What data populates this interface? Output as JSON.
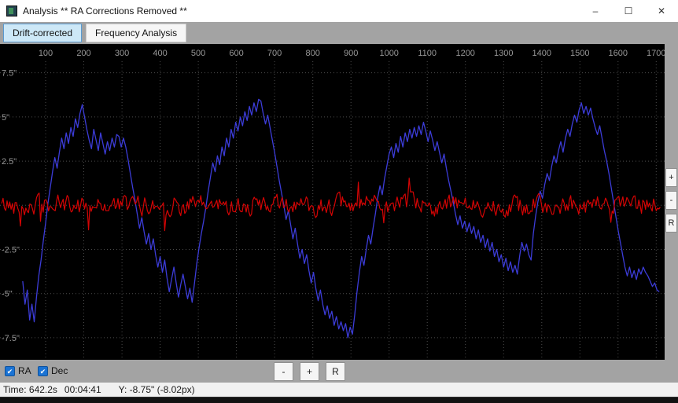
{
  "window": {
    "title": "Analysis ** RA Corrections Removed **",
    "controls": {
      "minimize": "–",
      "maximize": "☐",
      "close": "✕"
    }
  },
  "tabs": [
    {
      "label": "Drift-corrected",
      "selected": true
    },
    {
      "label": "Frequency Analysis",
      "selected": false
    }
  ],
  "icons": {
    "check": "✔"
  },
  "side_controls": {
    "zoom_in": "+",
    "zoom_out": "-",
    "reset": "R"
  },
  "bottom_controls": {
    "checkboxes": [
      {
        "label": "RA",
        "checked": true
      },
      {
        "label": "Dec",
        "checked": true
      }
    ],
    "buttons": [
      "-",
      "+",
      "R"
    ]
  },
  "status_bar": {
    "time": "Time: 642.2s",
    "clock": "00:04:41",
    "y_readout": "Y: -8.75\" (-8.02px)"
  },
  "colors": {
    "window_bg": "#ffffff",
    "strip_bg": "#a3a3a3",
    "chart_bg": "#000000",
    "grid": "#4c4c4c",
    "tick_text": "#989898",
    "dec_line": "#3c3cd8",
    "ra_line": "#d40404",
    "selected_tab_bg": "#cde8f7",
    "selected_tab_border": "#5b9bd0",
    "checkbox_blue": "#1a73d4",
    "status_bg": "#f1f1f1"
  },
  "chart_data": {
    "type": "line",
    "title": "",
    "xlabel": "",
    "ylabel": "",
    "grid": true,
    "xlim": [
      -19.6,
      1722
    ],
    "ylim": [
      -8.75,
      9.13
    ],
    "x_ticks": [
      100,
      200,
      300,
      400,
      500,
      600,
      700,
      800,
      900,
      1000,
      1100,
      1200,
      1300,
      1400,
      1500,
      1600,
      1700
    ],
    "y_ticks": [
      {
        "value": 7.5,
        "label": "7.5\""
      },
      {
        "value": 5,
        "label": "5\""
      },
      {
        "value": 2.5,
        "label": "2.5\""
      },
      {
        "value": -2.5,
        "label": "-2.5\""
      },
      {
        "value": -5,
        "label": "-5\""
      },
      {
        "value": -7.5,
        "label": "-7.5\""
      }
    ],
    "grid_y": [
      7.5,
      5,
      2.5,
      0,
      -2.5,
      -5,
      -7.5
    ],
    "series": [
      {
        "name": "Dec",
        "color": "#3c3cd8",
        "points": [
          [
            40,
            -4.3
          ],
          [
            46,
            -5.6
          ],
          [
            52,
            -4.8
          ],
          [
            58,
            -6.5
          ],
          [
            64,
            -5.6
          ],
          [
            70,
            -6.6
          ],
          [
            76,
            -5.2
          ],
          [
            82,
            -4.0
          ],
          [
            88,
            -3.1
          ],
          [
            94,
            -2.0
          ],
          [
            100,
            -1.0
          ],
          [
            106,
            0.1
          ],
          [
            112,
            1.0
          ],
          [
            118,
            1.9
          ],
          [
            124,
            2.7
          ],
          [
            130,
            2.1
          ],
          [
            136,
            3.0
          ],
          [
            142,
            3.8
          ],
          [
            148,
            3.2
          ],
          [
            154,
            4.1
          ],
          [
            160,
            3.5
          ],
          [
            166,
            4.4
          ],
          [
            172,
            3.9
          ],
          [
            178,
            4.9
          ],
          [
            184,
            4.4
          ],
          [
            190,
            5.2
          ],
          [
            196,
            5.7
          ],
          [
            202,
            5.0
          ],
          [
            208,
            4.3
          ],
          [
            214,
            3.7
          ],
          [
            220,
            3.2
          ],
          [
            226,
            4.3
          ],
          [
            232,
            3.7
          ],
          [
            238,
            3.1
          ],
          [
            244,
            4.1
          ],
          [
            250,
            3.5
          ],
          [
            256,
            2.9
          ],
          [
            262,
            3.6
          ],
          [
            268,
            3.1
          ],
          [
            274,
            3.8
          ],
          [
            280,
            3.3
          ],
          [
            286,
            4.0
          ],
          [
            292,
            3.9
          ],
          [
            298,
            3.3
          ],
          [
            304,
            3.8
          ],
          [
            310,
            3.3
          ],
          [
            316,
            2.6
          ],
          [
            322,
            1.8
          ],
          [
            328,
            1.0
          ],
          [
            334,
            0.3
          ],
          [
            340,
            -0.5
          ],
          [
            346,
            -1.3
          ],
          [
            352,
            -0.7
          ],
          [
            358,
            -1.5
          ],
          [
            364,
            -2.2
          ],
          [
            370,
            -1.6
          ],
          [
            376,
            -2.5
          ],
          [
            382,
            -1.9
          ],
          [
            388,
            -2.8
          ],
          [
            394,
            -3.5
          ],
          [
            400,
            -2.9
          ],
          [
            406,
            -3.8
          ],
          [
            412,
            -3.1
          ],
          [
            418,
            -4.1
          ],
          [
            424,
            -4.9
          ],
          [
            430,
            -4.2
          ],
          [
            436,
            -3.5
          ],
          [
            442,
            -4.4
          ],
          [
            448,
            -5.2
          ],
          [
            454,
            -4.5
          ],
          [
            460,
            -3.9
          ],
          [
            466,
            -4.6
          ],
          [
            472,
            -5.3
          ],
          [
            478,
            -4.7
          ],
          [
            484,
            -5.5
          ],
          [
            490,
            -4.4
          ],
          [
            496,
            -3.3
          ],
          [
            502,
            -2.4
          ],
          [
            508,
            -1.6
          ],
          [
            514,
            -0.9
          ],
          [
            520,
            -0.1
          ],
          [
            526,
            0.8
          ],
          [
            532,
            1.6
          ],
          [
            538,
            2.4
          ],
          [
            544,
            1.9
          ],
          [
            550,
            2.8
          ],
          [
            556,
            2.3
          ],
          [
            562,
            3.3
          ],
          [
            568,
            2.8
          ],
          [
            574,
            3.8
          ],
          [
            580,
            3.3
          ],
          [
            586,
            4.3
          ],
          [
            592,
            3.8
          ],
          [
            598,
            4.7
          ],
          [
            604,
            4.2
          ],
          [
            610,
            5.0
          ],
          [
            616,
            4.5
          ],
          [
            622,
            5.3
          ],
          [
            628,
            4.8
          ],
          [
            634,
            5.6
          ],
          [
            640,
            5.1
          ],
          [
            646,
            5.8
          ],
          [
            652,
            5.3
          ],
          [
            658,
            6.0
          ],
          [
            664,
            5.9
          ],
          [
            670,
            5.2
          ],
          [
            676,
            4.6
          ],
          [
            682,
            5.1
          ],
          [
            688,
            4.4
          ],
          [
            694,
            3.7
          ],
          [
            700,
            3.0
          ],
          [
            706,
            2.2
          ],
          [
            712,
            1.4
          ],
          [
            718,
            0.7
          ],
          [
            724,
            0.0
          ],
          [
            730,
            -0.8
          ],
          [
            736,
            -0.3
          ],
          [
            742,
            -1.1
          ],
          [
            748,
            -1.9
          ],
          [
            754,
            -1.3
          ],
          [
            760,
            -2.2
          ],
          [
            766,
            -3.0
          ],
          [
            772,
            -2.5
          ],
          [
            778,
            -3.3
          ],
          [
            784,
            -2.8
          ],
          [
            790,
            -3.7
          ],
          [
            796,
            -4.4
          ],
          [
            802,
            -3.8
          ],
          [
            808,
            -4.7
          ],
          [
            814,
            -5.4
          ],
          [
            820,
            -4.8
          ],
          [
            826,
            -5.6
          ],
          [
            832,
            -6.2
          ],
          [
            838,
            -5.7
          ],
          [
            844,
            -6.4
          ],
          [
            850,
            -6.0
          ],
          [
            856,
            -6.8
          ],
          [
            862,
            -6.3
          ],
          [
            868,
            -7.0
          ],
          [
            874,
            -6.6
          ],
          [
            880,
            -7.1
          ],
          [
            886,
            -6.7
          ],
          [
            892,
            -7.5
          ],
          [
            898,
            -6.9
          ],
          [
            904,
            -7.3
          ],
          [
            910,
            -6.2
          ],
          [
            916,
            -4.9
          ],
          [
            922,
            -3.8
          ],
          [
            928,
            -2.9
          ],
          [
            934,
            -3.4
          ],
          [
            940,
            -2.5
          ],
          [
            946,
            -1.7
          ],
          [
            952,
            -2.2
          ],
          [
            958,
            -1.3
          ],
          [
            964,
            -0.5
          ],
          [
            970,
            0.4
          ],
          [
            976,
            1.1
          ],
          [
            982,
            0.6
          ],
          [
            988,
            1.5
          ],
          [
            994,
            2.2
          ],
          [
            1000,
            2.9
          ],
          [
            1006,
            3.3
          ],
          [
            1012,
            2.7
          ],
          [
            1018,
            3.5
          ],
          [
            1024,
            3.0
          ],
          [
            1030,
            3.9
          ],
          [
            1036,
            3.3
          ],
          [
            1042,
            4.1
          ],
          [
            1048,
            3.6
          ],
          [
            1054,
            4.3
          ],
          [
            1060,
            3.8
          ],
          [
            1066,
            4.4
          ],
          [
            1072,
            3.9
          ],
          [
            1078,
            4.5
          ],
          [
            1084,
            4.0
          ],
          [
            1090,
            4.7
          ],
          [
            1096,
            4.2
          ],
          [
            1102,
            3.6
          ],
          [
            1108,
            4.2
          ],
          [
            1114,
            3.7
          ],
          [
            1120,
            3.1
          ],
          [
            1126,
            3.6
          ],
          [
            1132,
            3.0
          ],
          [
            1138,
            2.4
          ],
          [
            1144,
            2.9
          ],
          [
            1150,
            2.1
          ],
          [
            1156,
            1.4
          ],
          [
            1162,
            0.8
          ],
          [
            1168,
            0.2
          ],
          [
            1174,
            -0.5
          ],
          [
            1180,
            -1.1
          ],
          [
            1186,
            -0.6
          ],
          [
            1192,
            -1.3
          ],
          [
            1198,
            -0.9
          ],
          [
            1204,
            -1.5
          ],
          [
            1210,
            -1.0
          ],
          [
            1216,
            -1.6
          ],
          [
            1222,
            -1.2
          ],
          [
            1228,
            -1.9
          ],
          [
            1234,
            -1.4
          ],
          [
            1240,
            -2.1
          ],
          [
            1246,
            -1.7
          ],
          [
            1252,
            -2.4
          ],
          [
            1258,
            -1.9
          ],
          [
            1264,
            -2.6
          ],
          [
            1270,
            -2.1
          ],
          [
            1276,
            -2.9
          ],
          [
            1282,
            -2.5
          ],
          [
            1288,
            -3.2
          ],
          [
            1294,
            -2.8
          ],
          [
            1300,
            -3.5
          ],
          [
            1306,
            -3.0
          ],
          [
            1312,
            -3.7
          ],
          [
            1318,
            -3.2
          ],
          [
            1324,
            -3.8
          ],
          [
            1330,
            -3.4
          ],
          [
            1336,
            -3.9
          ],
          [
            1342,
            -2.9
          ],
          [
            1348,
            -2.1
          ],
          [
            1354,
            -2.6
          ],
          [
            1360,
            -2.2
          ],
          [
            1366,
            -2.8
          ],
          [
            1372,
            -3.1
          ],
          [
            1378,
            -1.6
          ],
          [
            1384,
            -0.6
          ],
          [
            1390,
            0.2
          ],
          [
            1396,
            0.8
          ],
          [
            1402,
            0.4
          ],
          [
            1408,
            1.2
          ],
          [
            1414,
            1.8
          ],
          [
            1420,
            1.4
          ],
          [
            1426,
            2.2
          ],
          [
            1432,
            2.8
          ],
          [
            1438,
            2.4
          ],
          [
            1444,
            3.1
          ],
          [
            1450,
            3.6
          ],
          [
            1456,
            3.0
          ],
          [
            1462,
            3.8
          ],
          [
            1468,
            4.3
          ],
          [
            1474,
            3.9
          ],
          [
            1480,
            4.6
          ],
          [
            1486,
            5.1
          ],
          [
            1492,
            4.7
          ],
          [
            1498,
            5.4
          ],
          [
            1504,
            5.8
          ],
          [
            1510,
            5.2
          ],
          [
            1516,
            5.6
          ],
          [
            1522,
            5.1
          ],
          [
            1528,
            5.5
          ],
          [
            1534,
            4.9
          ],
          [
            1540,
            4.4
          ],
          [
            1546,
            4.0
          ],
          [
            1552,
            4.5
          ],
          [
            1558,
            3.8
          ],
          [
            1564,
            3.1
          ],
          [
            1570,
            2.5
          ],
          [
            1576,
            1.8
          ],
          [
            1582,
            1.0
          ],
          [
            1588,
            0.2
          ],
          [
            1594,
            -0.6
          ],
          [
            1600,
            -1.4
          ],
          [
            1606,
            -2.1
          ],
          [
            1612,
            -2.8
          ],
          [
            1618,
            -3.5
          ],
          [
            1624,
            -4.0
          ],
          [
            1630,
            -3.5
          ],
          [
            1636,
            -4.1
          ],
          [
            1642,
            -3.7
          ],
          [
            1648,
            -4.2
          ],
          [
            1654,
            -3.6
          ],
          [
            1660,
            -3.9
          ],
          [
            1666,
            -3.5
          ],
          [
            1672,
            -3.8
          ],
          [
            1678,
            -4.0
          ],
          [
            1684,
            -4.3
          ],
          [
            1690,
            -4.6
          ],
          [
            1696,
            -4.4
          ],
          [
            1702,
            -4.8
          ],
          [
            1708,
            -4.9
          ]
        ]
      },
      {
        "name": "RA",
        "color": "#d40404",
        "noise": {
          "x_start": -15,
          "x_end": 1712,
          "step": 3.5,
          "amplitude": 0.5,
          "smooth": 0.4,
          "spike_probability": 0.03,
          "spike_amplitude": 0.9,
          "seed": 42
        }
      }
    ]
  }
}
